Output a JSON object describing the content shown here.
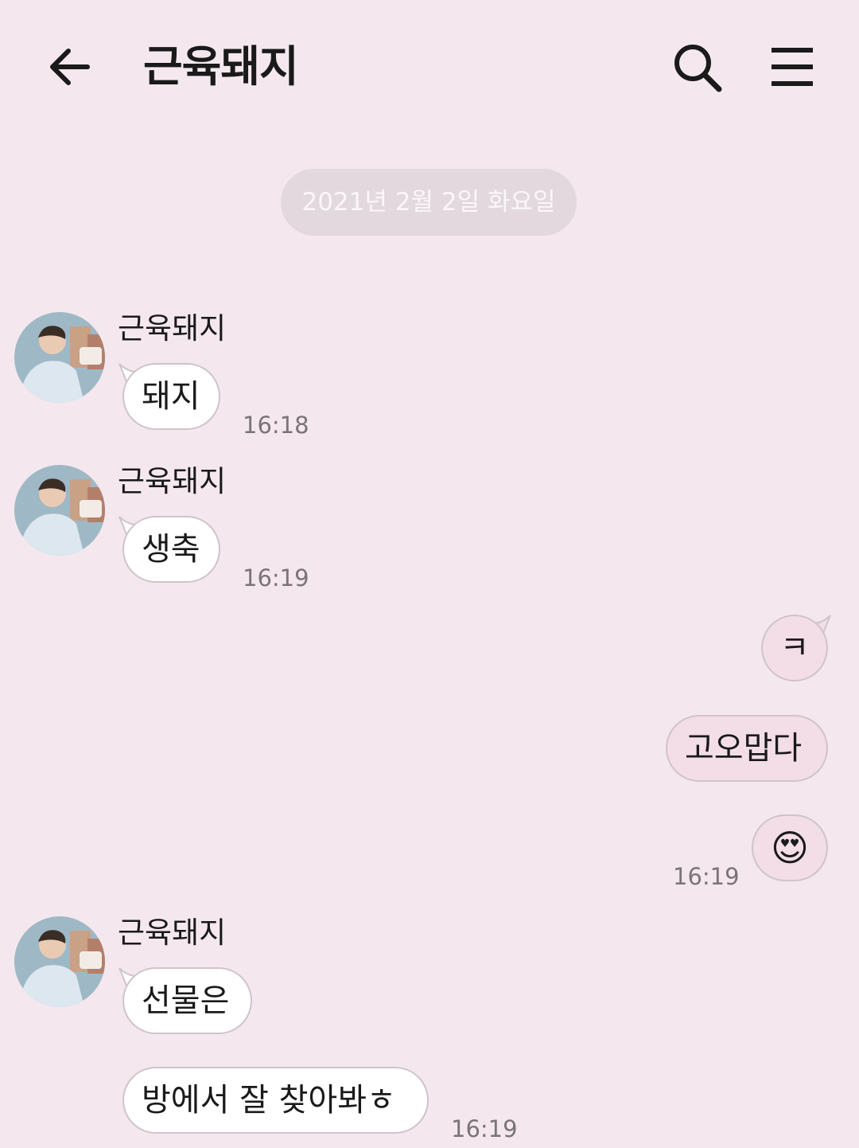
{
  "header": {
    "title": "근육돼지",
    "back_icon": "arrow-left-icon",
    "search_icon": "search-icon",
    "menu_icon": "hamburger-menu-icon"
  },
  "date_divider": "2021년 2월 2일 화요일",
  "messages": [
    {
      "sender": "근육돼지",
      "text": "돼지",
      "time": "16:18"
    },
    {
      "sender": "근육돼지",
      "text": "생축",
      "time": "16:19"
    },
    {
      "text": "ㅋ"
    },
    {
      "text": "고오맙다"
    },
    {
      "text": "😍",
      "time": "16:19"
    },
    {
      "sender": "근육돼지",
      "text": "선물은"
    },
    {
      "text": "방에서 잘 찾아봐ㅎ",
      "time": "16:19"
    }
  ],
  "colors": {
    "background": "#f4e8ee",
    "incoming_bubble": "#ffffff",
    "outgoing_bubble": "#f3dde6",
    "date_pill": "#e3d8de"
  }
}
